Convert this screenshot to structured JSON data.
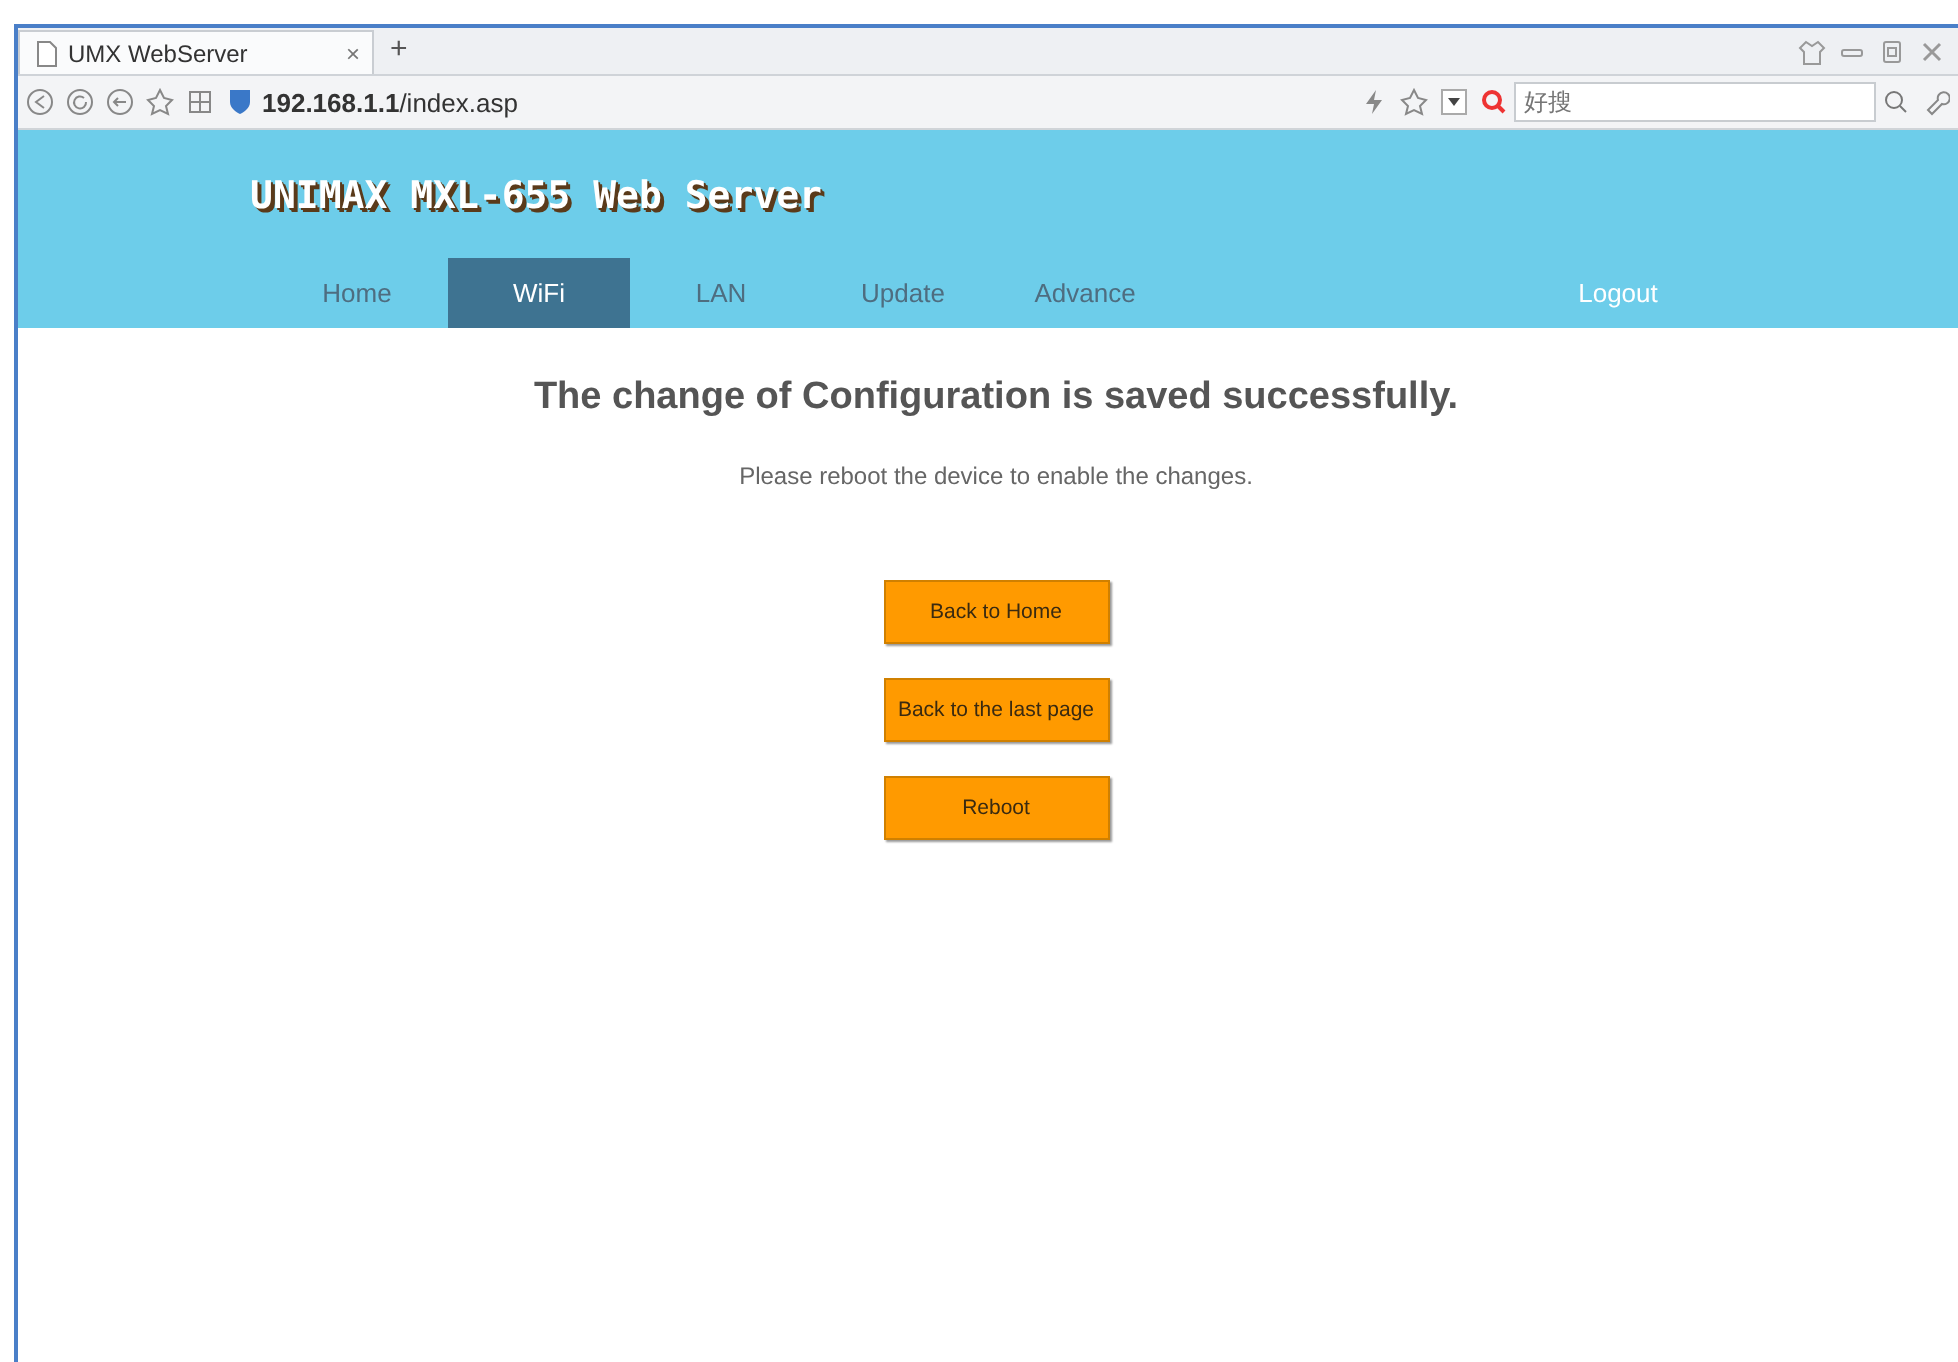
{
  "browser": {
    "tabs": [
      {
        "title": "UMX WebServer",
        "selected": true,
        "close": "×"
      }
    ],
    "new_tab": "+",
    "address": {
      "host": "192.168.1.1",
      "path": "/index.asp"
    },
    "search": {
      "placeholder": "好搜"
    }
  },
  "header": {
    "title": "UNIMAX MXL-655 Web Server"
  },
  "nav": [
    {
      "label": "Home",
      "selected": false
    },
    {
      "label": "WiFi",
      "selected": true
    },
    {
      "label": "LAN",
      "selected": false
    },
    {
      "label": "Update",
      "selected": false
    },
    {
      "label": "Advance",
      "selected": false
    }
  ],
  "logout": "Logout",
  "message": {
    "heading": "The change of Configuration is saved successfully.",
    "note": "Please reboot the device to enable the changes."
  },
  "buttons": [
    "Back to Home",
    "Back to the last page",
    "Reboot"
  ]
}
